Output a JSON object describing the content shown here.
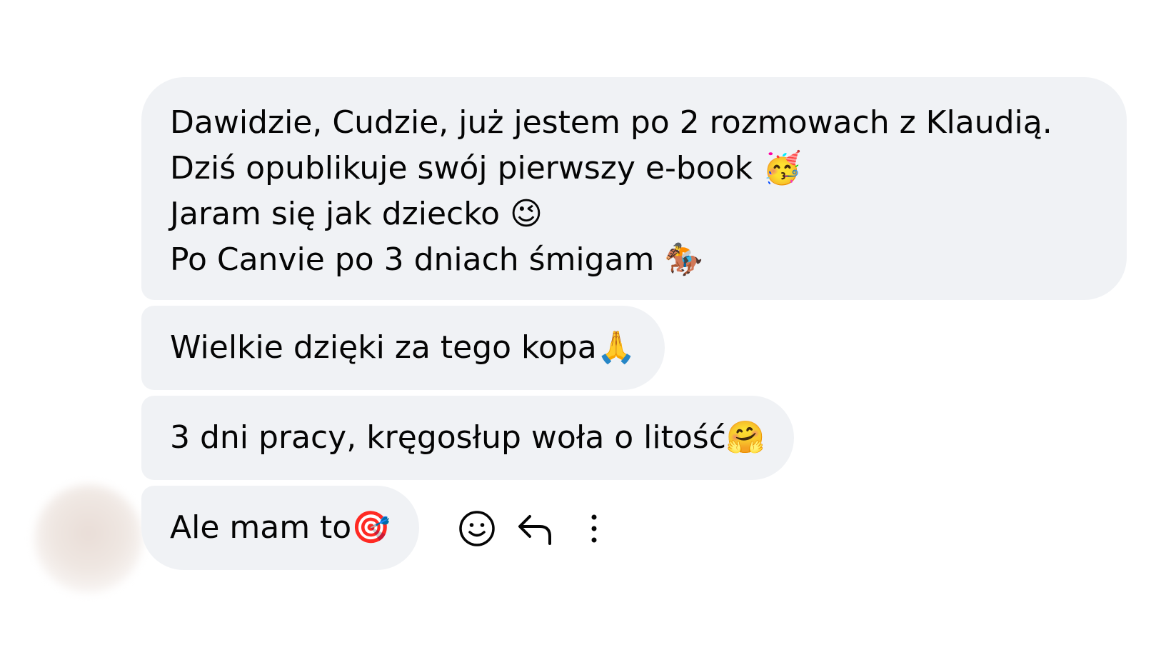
{
  "messages": [
    {
      "lines": [
        {
          "text": "Dawidzie, Cudzie, już jestem po 2 rozmowach z Klaudią.",
          "emoji": ""
        },
        {
          "text": "Dziś opublikuje swój pierwszy e-book ",
          "emoji": "🥳"
        },
        {
          "text": "Jaram się jak dziecko ",
          "emoji": "😉"
        },
        {
          "text": "Po Canvie po 3 dniach śmigam ",
          "emoji": "🏇"
        }
      ]
    },
    {
      "text": "Wielkie dzięki za tego kopa",
      "emoji": "🙏"
    },
    {
      "text": "3 dni pracy, kręgosłup woła o litość",
      "emoji": "🤗"
    },
    {
      "text": "Ale mam to",
      "emoji": "🎯"
    }
  ],
  "actions": {
    "react_icon": "smiley-face-icon",
    "reply_icon": "reply-arrow-icon",
    "more_icon": "more-vertical-icon"
  },
  "colors": {
    "bubble": "#f0f2f5",
    "text": "#050505",
    "icon": "#050505"
  }
}
